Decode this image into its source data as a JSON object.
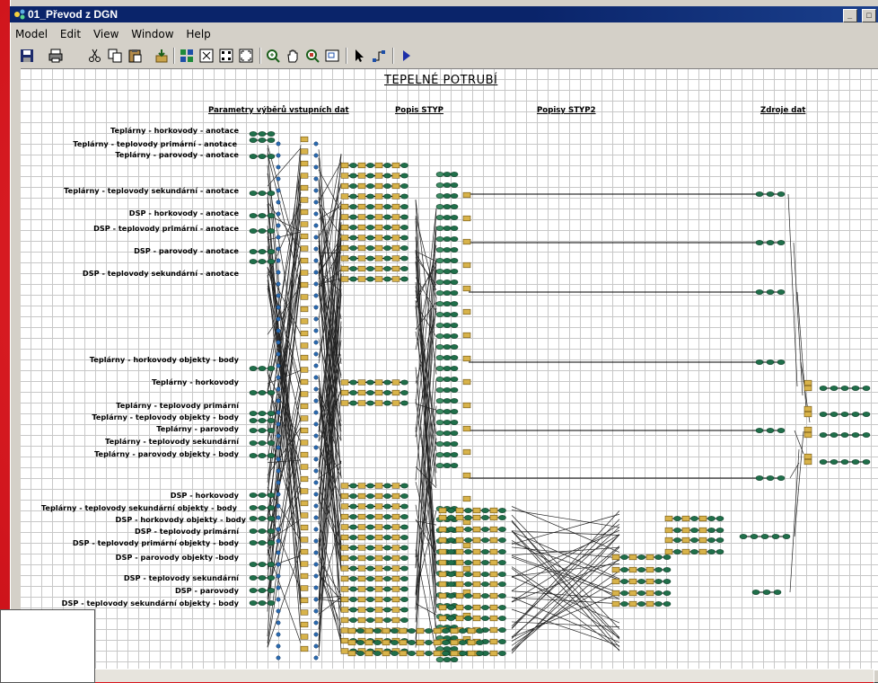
{
  "window": {
    "title": "01_Převod z DGN",
    "min_symbol": "_",
    "max_symbol": "□"
  },
  "menu": {
    "items": [
      {
        "label": "Model"
      },
      {
        "label": "Edit"
      },
      {
        "label": "View"
      },
      {
        "label": "Window"
      },
      {
        "label": "Help"
      }
    ]
  },
  "toolbar": {
    "buttons": [
      "save-icon",
      "print-icon",
      "cut-icon",
      "copy-icon",
      "paste-icon",
      "add-icon",
      "grid-icon",
      "select-all-icon",
      "layout-icon",
      "fit-icon",
      "zoom-icon",
      "pan-icon",
      "zoom-window-icon",
      "overview-icon",
      "pointer-icon",
      "connect-icon",
      "run-icon"
    ]
  },
  "canvas": {
    "title": "TEPELNÉ POTRUBÍ",
    "headers": {
      "params": "Parametry výběrů vstupních dat",
      "popis": "Popis STYP",
      "popisy2": "Popisy STYP2",
      "zdroje": "Zdroje dat"
    },
    "labels": [
      "Teplárny - horkovody - anotace",
      "Teplárny - teplovody primární - anotace",
      "Teplárny - parovody - anotace",
      "Teplárny - teplovody sekundární - anotace",
      "DSP - horkovody - anotace",
      "DSP - teplovody primární - anotace",
      "DSP - parovody - anotace",
      "DSP - teplovody sekundární - anotace",
      "Teplárny - horkovody objekty - body",
      "Teplárny - horkovody",
      "Teplárny - teplovody primární",
      "Teplárny - teplovody objekty - body",
      "Teplárny - parovody",
      "Teplárny - teplovody sekundární",
      "Teplárny - parovody objekty - body",
      "DSP - horkovody",
      "Teplárny - teplovody sekundární objekty - body",
      "DSP - horkovody objekty - body",
      "DSP - teplovody primární",
      "DSP - teplovody primární objekty - body",
      "DSP - parovody objekty -body",
      "DSP - teplovody sekundární",
      "DSP - parovody",
      "DSP - teplovody sekundární objekty - body"
    ]
  }
}
